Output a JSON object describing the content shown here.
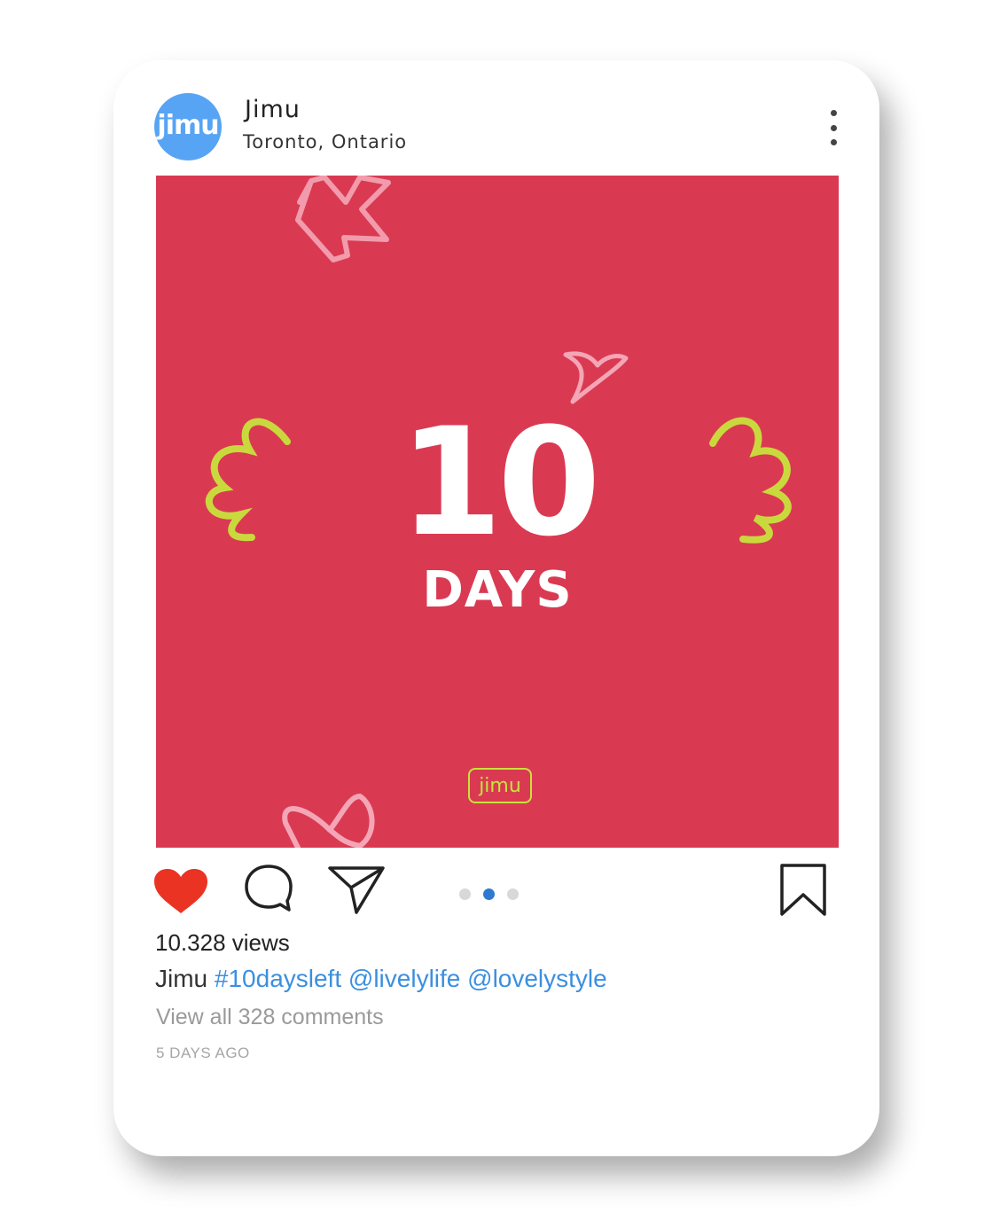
{
  "post": {
    "avatar_text": "jimu",
    "username": "Jimu",
    "location": "Toronto, Ontario",
    "image": {
      "number": "10",
      "unit": "DAYS",
      "brand": "jimu",
      "background_color": "#d93a52",
      "accent_color": "#c8e23c"
    },
    "views": "10.328 views",
    "caption": {
      "author": "Jimu",
      "tags": [
        "#10daysleft",
        "@livelylife",
        "@lovelystyle"
      ]
    },
    "comments_link": "View all 328 comments",
    "time_ago": "5 DAYS AGO",
    "carousel": {
      "count": 3,
      "active_index": 1
    },
    "liked": true,
    "like_color": "#ea3323"
  },
  "icons": {
    "like": "heart-icon",
    "comment": "comment-bubble-icon",
    "share": "paper-plane-icon",
    "save": "bookmark-icon",
    "menu": "more-vertical-icon"
  }
}
